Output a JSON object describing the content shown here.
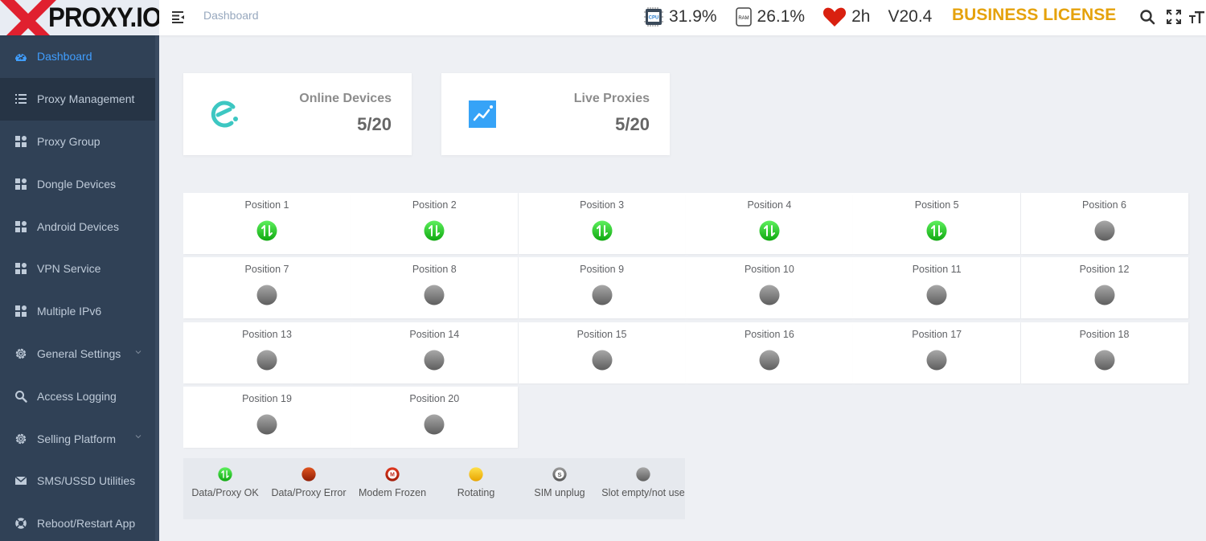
{
  "header": {
    "logo_text": "PROXY.IO",
    "breadcrumb": "Dashboard",
    "cpu": "31.9%",
    "ram": "26.1%",
    "uptime": "2h",
    "version": "V20.4",
    "license": "BUSINESS LICENSE",
    "icons": [
      "search-icon",
      "fullscreen-icon",
      "font-size-icon"
    ]
  },
  "sidebar": {
    "items": [
      {
        "label": "Dashboard",
        "icon": "dashboard-icon",
        "active": true
      },
      {
        "label": "Proxy Management",
        "icon": "list-icon"
      },
      {
        "label": "Proxy Group",
        "icon": "grid-icon"
      },
      {
        "label": "Dongle Devices",
        "icon": "grid-icon"
      },
      {
        "label": "Android Devices",
        "icon": "grid-icon"
      },
      {
        "label": "VPN Service",
        "icon": "grid-icon"
      },
      {
        "label": "Multiple IPv6",
        "icon": "grid-icon"
      },
      {
        "label": "General Settings",
        "icon": "gear-icon",
        "expandable": true
      },
      {
        "label": "Access Logging",
        "icon": "search-icon"
      },
      {
        "label": "Selling Platform",
        "icon": "gear-icon",
        "expandable": true
      },
      {
        "label": "SMS/USSD Utilities",
        "icon": "mail-icon"
      },
      {
        "label": "Reboot/Restart App",
        "icon": "lifebuoy-icon"
      }
    ]
  },
  "cards": [
    {
      "title": "Online Devices",
      "value": "5/20",
      "icon": "online-devices-icon"
    },
    {
      "title": "Live Proxies",
      "value": "5/20",
      "icon": "trend-chart-icon"
    }
  ],
  "positions": [
    {
      "label": "Position 1",
      "status": "ok"
    },
    {
      "label": "Position 2",
      "status": "ok"
    },
    {
      "label": "Position 3",
      "status": "ok"
    },
    {
      "label": "Position 4",
      "status": "ok"
    },
    {
      "label": "Position 5",
      "status": "ok"
    },
    {
      "label": "Position 6",
      "status": "empty"
    },
    {
      "label": "Position 7",
      "status": "empty"
    },
    {
      "label": "Position 8",
      "status": "empty"
    },
    {
      "label": "Position 9",
      "status": "empty"
    },
    {
      "label": "Position 10",
      "status": "empty"
    },
    {
      "label": "Position 11",
      "status": "empty"
    },
    {
      "label": "Position 12",
      "status": "empty"
    },
    {
      "label": "Position 13",
      "status": "empty"
    },
    {
      "label": "Position 14",
      "status": "empty"
    },
    {
      "label": "Position 15",
      "status": "empty"
    },
    {
      "label": "Position 16",
      "status": "empty"
    },
    {
      "label": "Position 17",
      "status": "empty"
    },
    {
      "label": "Position 18",
      "status": "empty"
    },
    {
      "label": "Position 19",
      "status": "empty"
    },
    {
      "label": "Position 20",
      "status": "empty"
    }
  ],
  "legend": [
    {
      "label": "Data/Proxy OK",
      "status": "ok"
    },
    {
      "label": "Data/Proxy Error",
      "status": "error"
    },
    {
      "label": "Modem Frozen",
      "status": "frozen"
    },
    {
      "label": "Rotating",
      "status": "rotating"
    },
    {
      "label": "SIM unplug",
      "status": "sim"
    },
    {
      "label": "Slot empty/not use",
      "status": "empty"
    }
  ],
  "colors": {
    "sidebar_bg": "#304156",
    "active": "#409eff",
    "license": "#e5a20c",
    "ok": "#22c322",
    "error": "#c0310c",
    "rotating": "#f5c211",
    "empty": "#7a7a7a"
  }
}
